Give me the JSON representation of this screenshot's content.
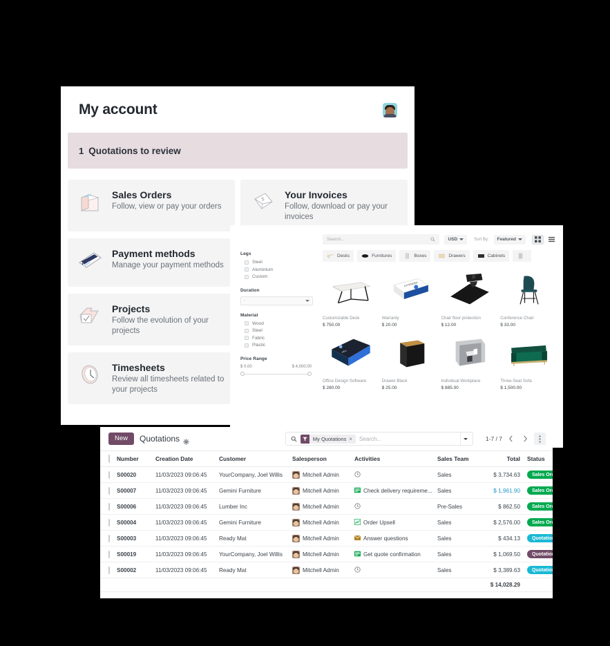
{
  "account": {
    "title": "My account",
    "avatar_name": "user-avatar",
    "banner": {
      "count": "1",
      "label": "Quotations to review"
    },
    "cards": [
      {
        "icon": "shopping-bag-icon",
        "title": "Sales Orders",
        "subtitle": "Follow, view or pay your orders"
      },
      {
        "icon": "invoice-envelope-icon",
        "title": "Your Invoices",
        "subtitle": "Follow, download or pay your invoices"
      },
      {
        "icon": "credit-card-icon",
        "title": "Payment methods",
        "subtitle": "Manage your payment methods"
      },
      {
        "icon": "folder-check-icon",
        "title": "Projects",
        "subtitle": "Follow the evolution of your projects"
      },
      {
        "icon": "clock-icon",
        "title": "Timesheets",
        "subtitle": "Review all timesheets related to your projects"
      }
    ]
  },
  "shop": {
    "search_placeholder": "Search...",
    "currency": "USD",
    "sort_by_label": "Sort By:",
    "sort_by_value": "Featured",
    "view_grid": "grid-view-icon",
    "view_list": "list-view-icon",
    "filters": [
      {
        "heading": "Legs",
        "type": "checkbox",
        "options": [
          "Steel",
          "Aluminium",
          "Custom"
        ]
      },
      {
        "heading": "Duration",
        "type": "select",
        "value": "-"
      },
      {
        "heading": "Material",
        "type": "checkbox",
        "options": [
          "Wood",
          "Steel",
          "Fabric",
          "Plastic"
        ]
      },
      {
        "heading": "Price Range",
        "type": "range",
        "min_label": "$ 0.00",
        "max_label": "$ 4,000.00"
      }
    ],
    "categories": [
      {
        "label": "Desks",
        "icon": "desk-icon"
      },
      {
        "label": "Furnitures",
        "icon": "sofa-icon"
      },
      {
        "label": "Boxes",
        "icon": "box-icon"
      },
      {
        "label": "Drawers",
        "icon": "drawer-icon"
      },
      {
        "label": "Cabinets",
        "icon": "cabinet-icon"
      },
      {
        "label": "",
        "icon": "bin-icon"
      }
    ],
    "products": [
      {
        "name": "Customizable Desk",
        "price": "$ 750.00",
        "image": "desk-photo"
      },
      {
        "name": "Warranty",
        "price": "$ 20.00",
        "image": "warranty-box-photo"
      },
      {
        "name": "Chair floor protection",
        "price": "$ 12.00",
        "image": "floor-mat-photo"
      },
      {
        "name": "Conference Chair",
        "price": "$ 33.00",
        "image": "conference-chair-photo"
      },
      {
        "name": "Office Design Software",
        "price": "$ 280.00",
        "image": "software-box-photo"
      },
      {
        "name": "Drawer Black",
        "price": "$ 25.00",
        "image": "drawer-black-photo"
      },
      {
        "name": "Individual Workplace",
        "price": "$ 885.00",
        "image": "workplace-pod-photo"
      },
      {
        "name": "Three-Seat Sofa",
        "price": "$ 1,500.00",
        "image": "sofa-photo"
      }
    ]
  },
  "quotations": {
    "new_button": "New",
    "breadcrumb": "Quotations",
    "facet_label": "My Quotations",
    "facet_remove": "×",
    "search_placeholder": "Search...",
    "pager_count": "1-7 / 7",
    "columns": [
      "Number",
      "Creation Date",
      "Customer",
      "Salesperson",
      "Activities",
      "Sales Team",
      "Total",
      "Status"
    ],
    "rows": [
      {
        "number": "S00020",
        "date": "11/03/2023 09:06:45",
        "customer": "YourCompany, Joel Willis",
        "salesperson": "Mitchell Admin",
        "activity": "",
        "activity_icon": "clock-icon",
        "team": "Sales",
        "total": "$ 3,734.63",
        "total_link": false,
        "status": "Sales Order",
        "status_color": "b-green"
      },
      {
        "number": "S00007",
        "date": "11/03/2023 09:06:45",
        "customer": "Gemini Furniture",
        "salesperson": "Mitchell Admin",
        "activity": "Check delivery requireme...",
        "activity_icon": "list-green-icon",
        "team": "Sales",
        "total": "$ 1,961.90",
        "total_link": true,
        "status": "Sales Order",
        "status_color": "b-green"
      },
      {
        "number": "S00006",
        "date": "11/03/2023 09:06:45",
        "customer": "Lumber Inc",
        "salesperson": "Mitchell Admin",
        "activity": "",
        "activity_icon": "clock-icon",
        "team": "Pre-Sales",
        "total": "$ 862.50",
        "total_link": false,
        "status": "Sales Order",
        "status_color": "b-green"
      },
      {
        "number": "S00004",
        "date": "11/03/2023 09:06:45",
        "customer": "Gemini Furniture",
        "salesperson": "Mitchell Admin",
        "activity": "Order Upsell",
        "activity_icon": "chart-up-icon",
        "team": "Sales",
        "total": "$ 2,576.00",
        "total_link": false,
        "status": "Sales Order",
        "status_color": "b-green"
      },
      {
        "number": "S00003",
        "date": "11/03/2023 09:06:45",
        "customer": "Ready Mat",
        "salesperson": "Mitchell Admin",
        "activity": "Answer questions",
        "activity_icon": "envelope-icon",
        "team": "Sales",
        "total": "$ 434.13",
        "total_link": false,
        "status": "Quotation",
        "status_color": "b-cyan"
      },
      {
        "number": "S00019",
        "date": "11/03/2023 09:06:45",
        "customer": "YourCompany, Joel Willis",
        "salesperson": "Mitchell Admin",
        "activity": "Get quote confirmation",
        "activity_icon": "list-green-icon",
        "team": "Sales",
        "total": "$ 1,069.50",
        "total_link": false,
        "status": "Quotation Sent",
        "status_color": "b-plum"
      },
      {
        "number": "S00002",
        "date": "11/03/2023 09:06:45",
        "customer": "Ready Mat",
        "salesperson": "Mitchell Admin",
        "activity": "",
        "activity_icon": "clock-icon",
        "team": "Sales",
        "total": "$ 3,389.63",
        "total_link": false,
        "status": "Quotation",
        "status_color": "b-cyan"
      }
    ],
    "footer_total": "$ 14,028.29"
  },
  "colors": {
    "brand_plum": "#714b67",
    "banner_pink": "#e7dce0",
    "status_green": "#00a94f",
    "status_cyan": "#1bb8d4",
    "link_blue": "#2196c7"
  }
}
